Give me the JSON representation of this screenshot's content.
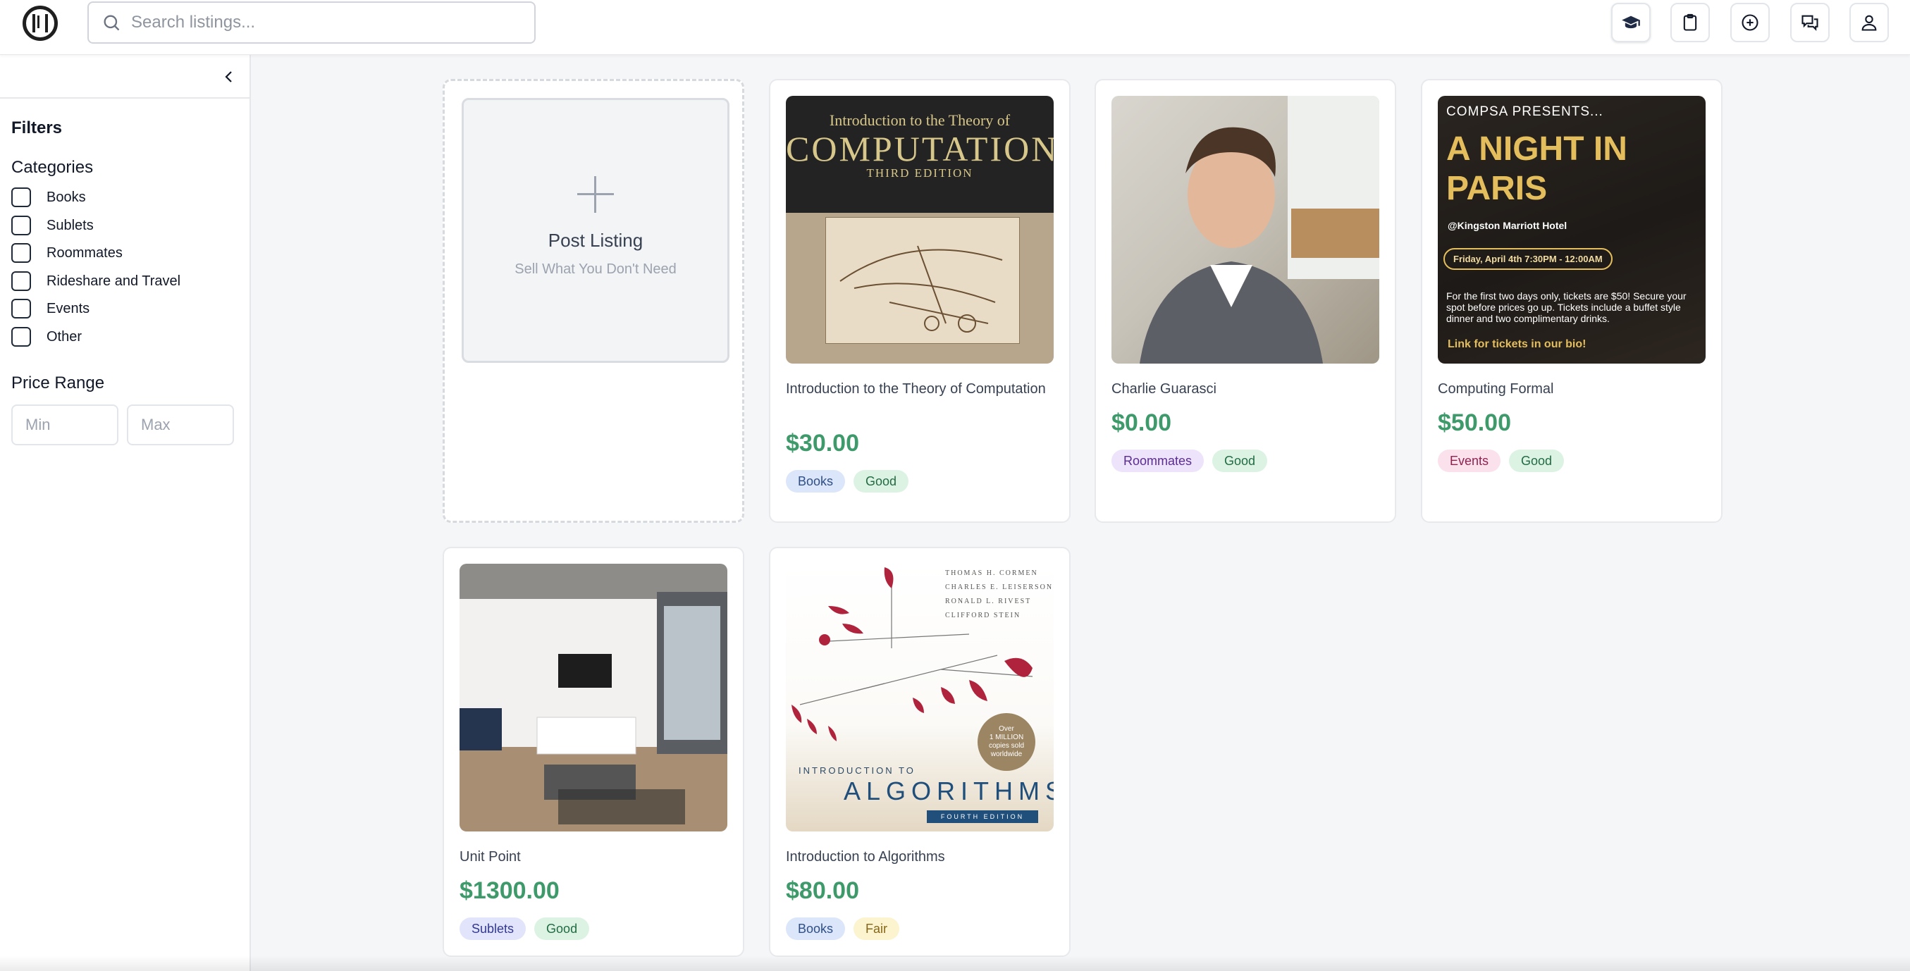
{
  "header": {
    "logo": "compsa-logo",
    "search": {
      "placeholder": "Search listings...",
      "value": ""
    },
    "actions": [
      {
        "name": "graduation-cap-icon"
      },
      {
        "name": "clipboard-icon"
      },
      {
        "name": "plus-circle-icon"
      },
      {
        "name": "chat-icon"
      },
      {
        "name": "user-icon"
      }
    ]
  },
  "sidebar": {
    "filters_title": "Filters",
    "categories_title": "Categories",
    "categories": [
      {
        "label": "Books",
        "checked": false
      },
      {
        "label": "Sublets",
        "checked": false
      },
      {
        "label": "Roommates",
        "checked": false
      },
      {
        "label": "Rideshare and Travel",
        "checked": false
      },
      {
        "label": "Events",
        "checked": false
      },
      {
        "label": "Other",
        "checked": false
      }
    ],
    "price_range_title": "Price Range",
    "price_min": {
      "placeholder": "Min",
      "value": ""
    },
    "price_max": {
      "placeholder": "Max",
      "value": ""
    }
  },
  "post_listing": {
    "title": "Post Listing",
    "subtitle": "Sell What You Don't Need"
  },
  "listings": [
    {
      "title": "Introduction to the Theory of Computation",
      "price": "$30.00",
      "category": "Books",
      "condition": "Good",
      "image": {
        "line1": "Introduction to the Theory of",
        "line2": "COMPUTATION",
        "line3": "THIRD EDITION"
      }
    },
    {
      "title": "Charlie Guarasci",
      "price": "$0.00",
      "category": "Roommates",
      "condition": "Good"
    },
    {
      "title": "Computing Formal",
      "price": "$50.00",
      "category": "Events",
      "condition": "Good",
      "image": {
        "presents": "COMPSA PRESENTS...",
        "headline": "A NIGHT IN PARIS",
        "venue": "@Kingston Marriott Hotel",
        "date": "Friday, April 4th 7:30PM - 12:00AM",
        "details": "For the first two days only, tickets are $50! Secure your spot before prices go up. Tickets include a buffet style dinner and two complimentary drinks.",
        "cta": "Link for tickets in our bio!"
      }
    },
    {
      "title": "Unit Point",
      "price": "$1300.00",
      "category": "Sublets",
      "condition": "Good"
    },
    {
      "title": "Introduction to Algorithms",
      "price": "$80.00",
      "category": "Books",
      "condition": "Fair",
      "image": {
        "authors": [
          "THOMAS H. CORMEN",
          "CHARLES E. LEISERSON",
          "RONALD L. RIVEST",
          "CLIFFORD STEIN"
        ],
        "badge_over": "Over",
        "badge_million": "1 MILLION",
        "badge_copies": "copies sold",
        "badge_world": "worldwide",
        "intro": "INTRODUCTION TO",
        "title": "ALGORITHMS",
        "edition": "FOURTH EDITION"
      }
    }
  ],
  "colors": {
    "price": "#3f9a6b",
    "tag_books_bg": "#dbe6fb",
    "tag_books_fg": "#2f4f86",
    "tag_good_bg": "#dcf3e4",
    "tag_good_fg": "#226b43",
    "tag_roommates_bg": "#ede3fb",
    "tag_roommates_fg": "#5b2d8f",
    "tag_events_bg": "#fbe1ec",
    "tag_events_fg": "#8f2250",
    "tag_sublets_bg": "#e2e4fb",
    "tag_sublets_fg": "#33388f",
    "tag_fair_bg": "#fbf4cf",
    "tag_fair_fg": "#86661a"
  }
}
